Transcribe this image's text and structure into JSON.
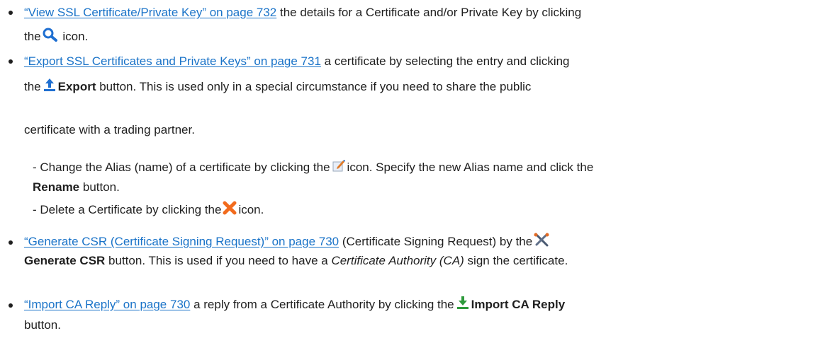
{
  "items": [
    {
      "link": "“View SSL Certificate/Private Key” on page 732",
      "text_a": " the details for a Certificate and/or Private Key by clicking",
      "text_b": "the",
      "text_c": " icon."
    },
    {
      "link": "“Export SSL Certificates and Private Keys” on page 731",
      "text_a": " a certificate by selecting the entry and clicking",
      "text_b": "the",
      "bold": "Export",
      "text_c": " button. This is used only in a special circumstance if you need to share the public",
      "text_d": "certificate with a trading partner."
    },
    {
      "text_a": "- Change the Alias (name) of a certificate by clicking the",
      "text_b": "icon. Specify the new Alias name and click the",
      "bold": "Rename",
      "text_c": " button."
    },
    {
      "text_a": "- Delete a Certificate by clicking the",
      "text_b": "icon."
    },
    {
      "link": "“Generate CSR (Certificate Signing Request)” on page 730",
      "text_a": " (Certificate Signing Request) by the",
      "bold": "Generate CSR",
      "text_b": " button. This is used if you need to have a ",
      "italic": "Certificate Authority (CA)",
      "text_c": " sign the certificate."
    },
    {
      "link": "“Import CA Reply” on page 730",
      "text_a": " a reply from a Certificate Authority by clicking the",
      "bold": "Import CA Reply",
      "text_b": "button."
    }
  ],
  "icons": {
    "search": "magnifier-icon",
    "export": "export-upload-icon",
    "edit": "edit-pencil-icon",
    "delete": "delete-x-icon",
    "generate": "tools-icon",
    "import": "import-download-icon"
  }
}
